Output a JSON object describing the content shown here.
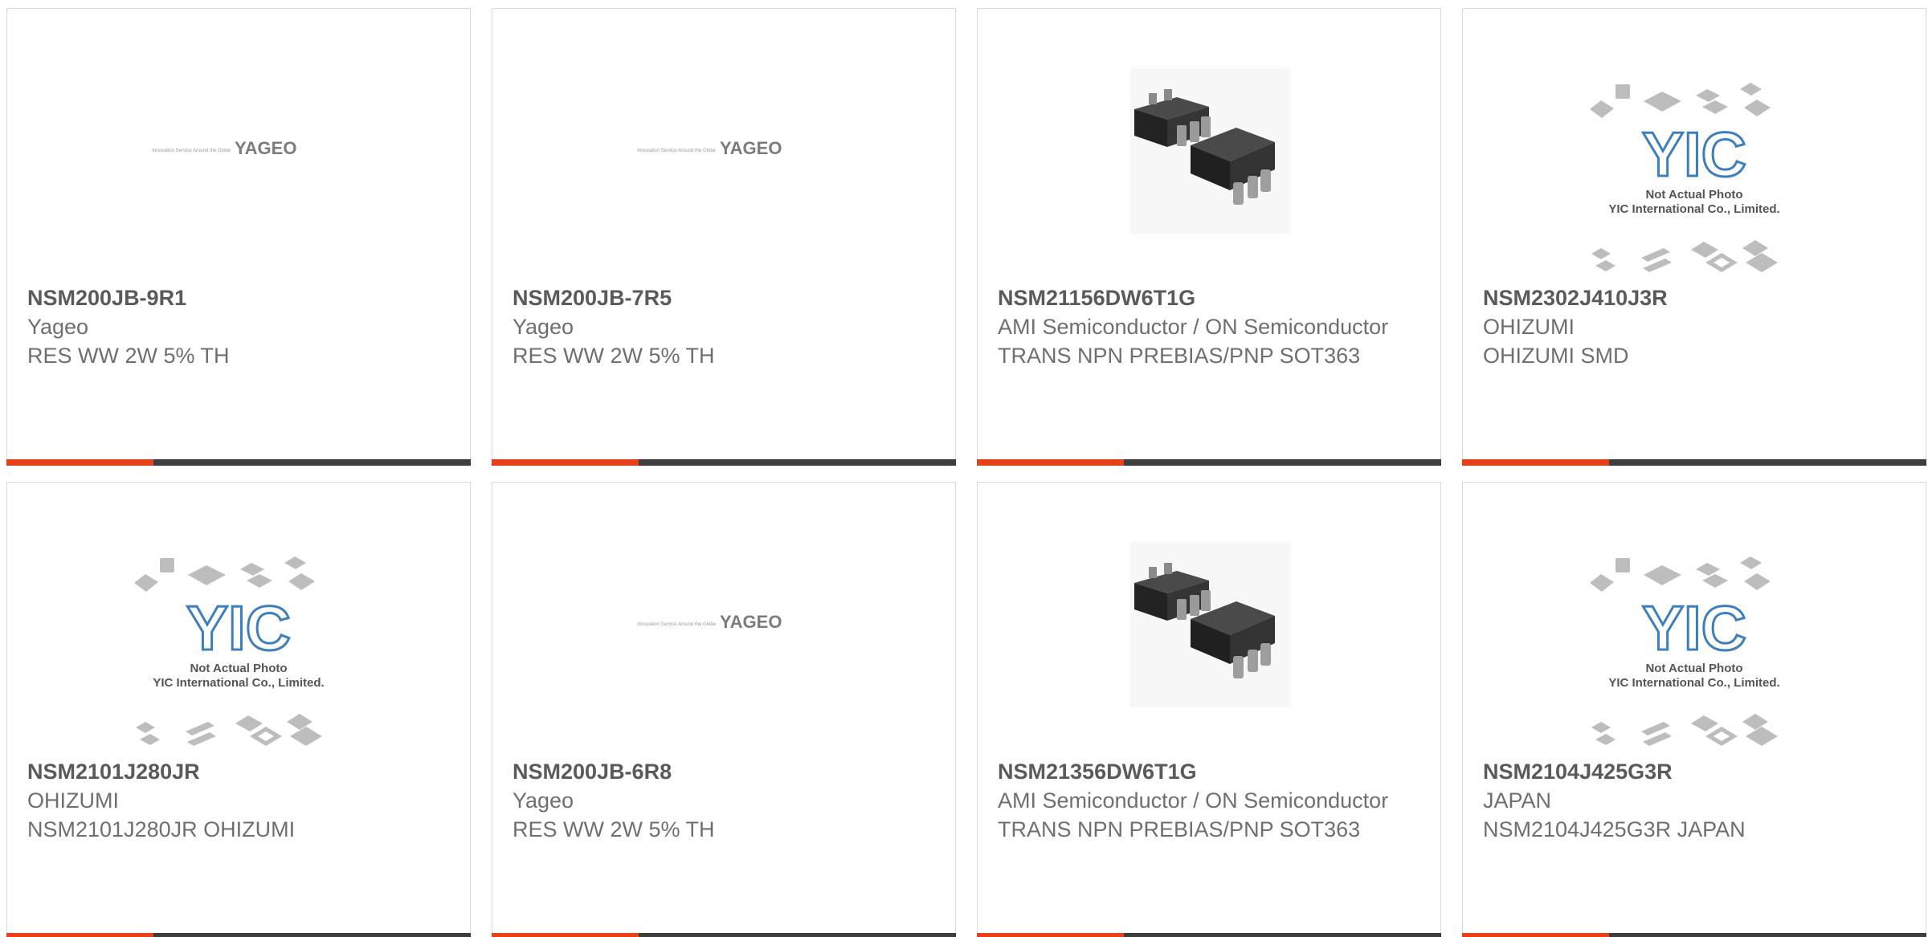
{
  "colors": {
    "accent": "#e8401b",
    "bar": "#3d3d3d",
    "text": "#6f6f6f",
    "border": "#d9d9d9"
  },
  "yageo_logo": {
    "tagline": "Innovation Service Around the Globe",
    "brand": "YAGEO"
  },
  "yic_placeholder": {
    "logo_text": "YIC",
    "line1": "Not Actual Photo",
    "line2": "YIC International Co., Limited."
  },
  "products": [
    {
      "part_number": "NSM200JB-9R1",
      "manufacturer": "Yageo",
      "description": "RES WW 2W 5% TH",
      "image": "yageo-logo"
    },
    {
      "part_number": "NSM200JB-7R5",
      "manufacturer": "Yageo",
      "description": "RES WW 2W 5% TH",
      "image": "yageo-logo"
    },
    {
      "part_number": "NSM21156DW6T1G",
      "manufacturer": "AMI Semiconductor / ON Semiconductor",
      "description": "TRANS NPN PREBIAS/PNP SOT363",
      "image": "sot363-photo"
    },
    {
      "part_number": "NSM2302J410J3R",
      "manufacturer": "OHIZUMI",
      "description": "OHIZUMI SMD",
      "image": "yic-placeholder"
    },
    {
      "part_number": "NSM2101J280JR",
      "manufacturer": "OHIZUMI",
      "description": "NSM2101J280JR OHIZUMI",
      "image": "yic-placeholder"
    },
    {
      "part_number": "NSM200JB-6R8",
      "manufacturer": "Yageo",
      "description": "RES WW 2W 5% TH",
      "image": "yageo-logo"
    },
    {
      "part_number": "NSM21356DW6T1G",
      "manufacturer": "AMI Semiconductor / ON Semiconductor",
      "description": "TRANS NPN PREBIAS/PNP SOT363",
      "image": "sot363-photo"
    },
    {
      "part_number": "NSM2104J425G3R",
      "manufacturer": "JAPAN",
      "description": "NSM2104J425G3R JAPAN",
      "image": "yic-placeholder"
    }
  ]
}
